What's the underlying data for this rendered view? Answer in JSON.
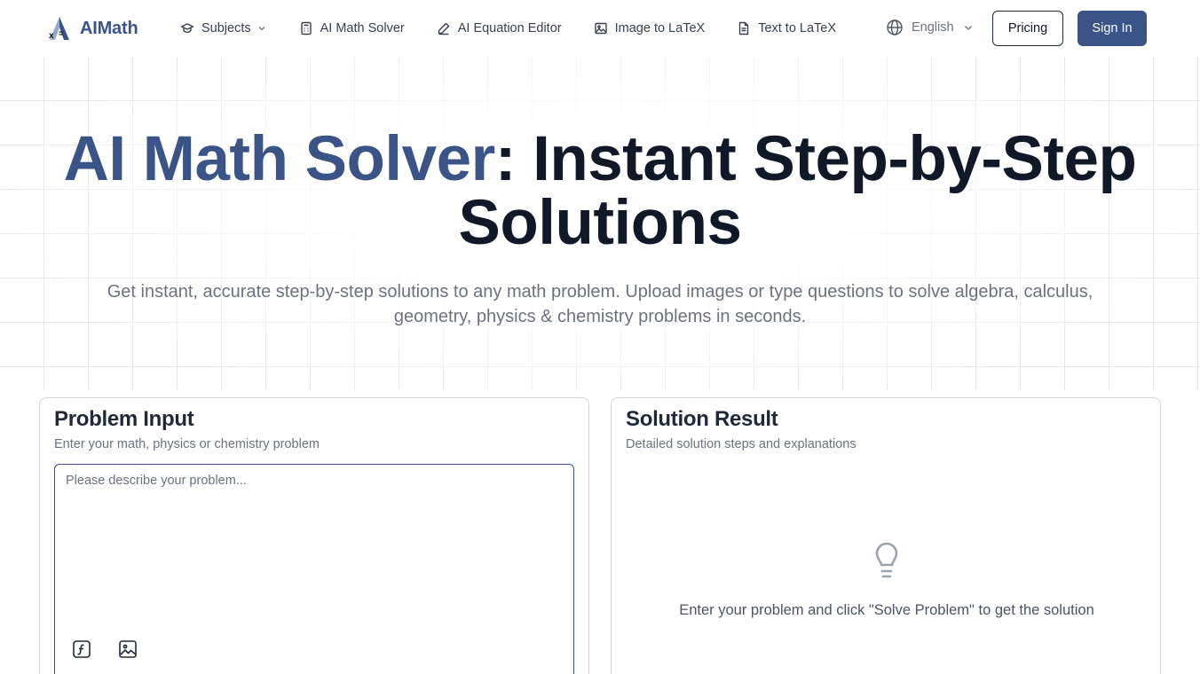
{
  "brand": {
    "name": "AIMath",
    "accent_color": "#3b5488"
  },
  "nav": {
    "items": [
      {
        "label": "Subjects",
        "icon": "graduation-cap-icon",
        "has_dropdown": true
      },
      {
        "label": "AI Math Solver",
        "icon": "calculator-icon"
      },
      {
        "label": "AI Equation Editor",
        "icon": "pencil-icon"
      },
      {
        "label": "Image to LaTeX",
        "icon": "image-icon"
      },
      {
        "label": "Text to LaTeX",
        "icon": "file-text-icon"
      }
    ],
    "language": {
      "label": "English",
      "icon": "globe-icon"
    },
    "pricing_label": "Pricing",
    "signin_label": "Sign In"
  },
  "hero": {
    "title_accent": "AI Math Solver",
    "title_rest": ": Instant Step-by-Step Solutions",
    "subtitle": "Get instant, accurate step-by-step solutions to any math problem. Upload images or type questions to solve algebra, calculus, geometry, physics & chemistry problems in seconds."
  },
  "input_panel": {
    "title": "Problem Input",
    "subtitle": "Enter your math, physics or chemistry problem",
    "placeholder": "Please describe your problem...",
    "value": "",
    "tools": [
      "function-icon",
      "image-upload-icon"
    ]
  },
  "result_panel": {
    "title": "Solution Result",
    "subtitle": "Detailed solution steps and explanations",
    "empty_icon": "lightbulb-icon",
    "empty_text": "Enter your problem and click \"Solve Problem\" to get the solution"
  }
}
